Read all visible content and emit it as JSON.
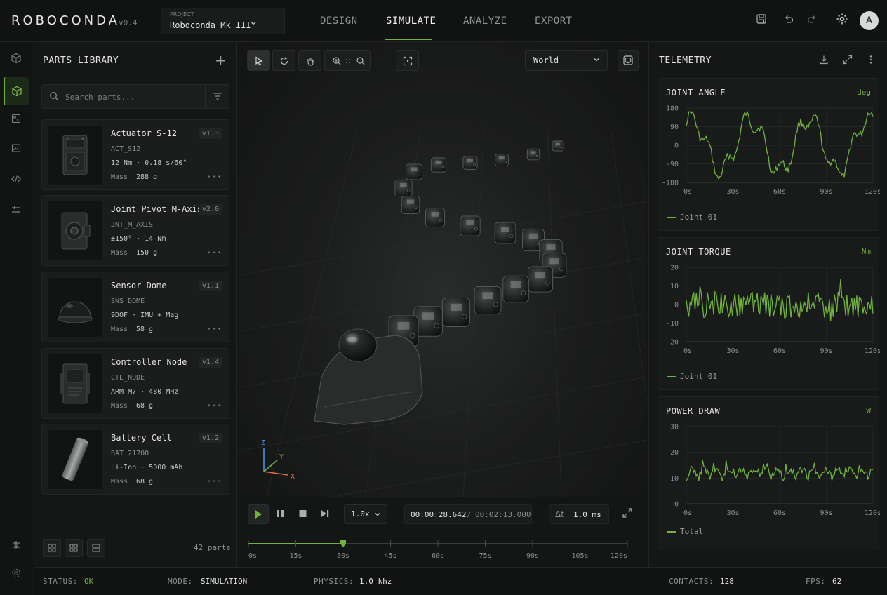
{
  "app": {
    "name": "ROBOCONDA",
    "version": "v0.4"
  },
  "project": {
    "label": "PROJECT",
    "name": "Roboconda Mk III"
  },
  "nav": {
    "tabs": [
      "DESIGN",
      "SIMULATE",
      "ANALYZE",
      "EXPORT"
    ],
    "active": "SIMULATE"
  },
  "user": {
    "initial": "A"
  },
  "parts_library": {
    "title": "PARTS LIBRARY",
    "search_placeholder": "Search parts...",
    "count_text": "42 parts",
    "mass_label": "Mass",
    "parts": [
      {
        "name": "Actuator S-12",
        "version": "v1.3",
        "code": "ACT_S12",
        "spec": "12 Nm · 0.18 s/60°",
        "mass": "288 g"
      },
      {
        "name": "Joint Pivot M-Axis",
        "version": "v2.0",
        "code": "JNT_M_AXIS",
        "spec": "±150° · 14 Nm",
        "mass": "150 g"
      },
      {
        "name": "Sensor Dome",
        "version": "v1.1",
        "code": "SNS_DOME",
        "spec": "9DOF · IMU + Mag",
        "mass": "58 g"
      },
      {
        "name": "Controller Node",
        "version": "v1.4",
        "code": "CTL_NODE",
        "spec": "ARM M7 · 480 MHz",
        "mass": "68 g"
      },
      {
        "name": "Battery Cell",
        "version": "v1.2",
        "code": "BAT_21700",
        "spec": "Li-Ion · 5000 mAh",
        "mass": "68 g"
      }
    ]
  },
  "viewport": {
    "frame": "World",
    "axes": {
      "x": "X",
      "y": "Y",
      "z": "Z"
    }
  },
  "playback": {
    "speed": "1.0x",
    "current_time": "00:00:28.642",
    "separator": "/",
    "total_time": "00:02:13.000",
    "dt_label": "Δt",
    "dt_value": "1.0 ms",
    "timeline_ticks": [
      "0s",
      "15s",
      "30s",
      "45s",
      "60s",
      "75s",
      "90s",
      "105s",
      "120s"
    ],
    "progress_seconds": 30,
    "timeline_max_seconds": 120
  },
  "telemetry": {
    "title": "TELEMETRY",
    "x_ticks": [
      "0s",
      "30s",
      "60s",
      "90s",
      "120s"
    ],
    "cards": [
      {
        "title": "JOINT ANGLE",
        "unit": "deg",
        "y_ticks": [
          "180",
          "90",
          "0",
          "-90",
          "-180"
        ],
        "legend": "Joint 01"
      },
      {
        "title": "JOINT TORQUE",
        "unit": "Nm",
        "y_ticks": [
          "20",
          "10",
          "0",
          "-10",
          "-20"
        ],
        "legend": "Joint 01"
      },
      {
        "title": "POWER DRAW",
        "unit": "W",
        "y_ticks": [
          "30",
          "20",
          "10",
          "0"
        ],
        "legend": "Total"
      }
    ]
  },
  "status": {
    "status_label": "STATUS:",
    "status_value": "OK",
    "mode_label": "MODE:",
    "mode_value": "SIMULATION",
    "physics_label": "PHYSICS:",
    "physics_value": "1.0 khz",
    "contacts_label": "CONTACTS:",
    "contacts_value": "128",
    "fps_label": "FPS:",
    "fps_value": "62"
  },
  "colors": {
    "accent": "#6fb33d",
    "background": "#141515",
    "panel": "#191a1a"
  }
}
